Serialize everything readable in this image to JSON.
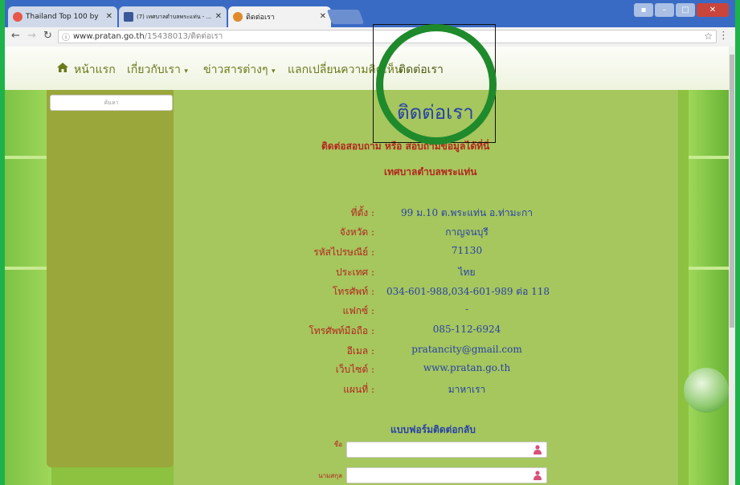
{
  "browser": {
    "tabs": [
      {
        "label": "Thailand Top 100 by",
        "icon_color": "#e8574a"
      },
      {
        "label": "(7) เทศบาลตำบลพระแท่น - ...",
        "icon_color": "#3b5998"
      },
      {
        "label": "ติดต่อเรา",
        "icon_color": "#e08a2c"
      }
    ],
    "url_host": "www.pratan.go.th",
    "url_path": "/15438013/ติดต่อเรา"
  },
  "nav": {
    "home": "หน้าแรก",
    "about": "เกี่ยวกับเรา",
    "news": "ข่าวสารต่างๆ",
    "exchange": "แลกเปลี่ยนความคิดเห็น",
    "contact": "ติดต่อเรา"
  },
  "sidebar": {
    "search_label": "ค้นหา"
  },
  "page": {
    "heading": "ติดต่อเรา",
    "intro": "ติดต่อสอบถาม หรือ สอบถามข้อมูลได้ที่นี่",
    "org_name": "เทศบาลตำบลพระแท่น"
  },
  "contact_rows": [
    {
      "label": "ที่ตั้ง :",
      "value": "99 ม.10 ต.พระแท่น อ.ท่ามะกา"
    },
    {
      "label": "จังหวัด :",
      "value": "กาญจนบุรี"
    },
    {
      "label": "รหัสไปรษณีย์ :",
      "value": "71130"
    },
    {
      "label": "ประเทศ :",
      "value": "ไทย"
    },
    {
      "label": "โทรศัพท์ :",
      "value": "034-601-988,034-601-989 ต่อ 118"
    },
    {
      "label": "แฟกซ์ :",
      "value": "-"
    },
    {
      "label": "โทรศัพท์มือถือ :",
      "value": "085-112-6924"
    },
    {
      "label": "อีเมล :",
      "value": "pratancity@gmail.com"
    },
    {
      "label": "เว็บไซต์ :",
      "value": "www.pratan.go.th"
    },
    {
      "label": "แผนที่ :",
      "value": "มาหาเรา"
    }
  ],
  "form": {
    "title": "แบบฟอร์มติดต่อกลับ",
    "name_label": "ชื่อ",
    "surname_label": "นามสกุล"
  },
  "colors": {
    "accent_red": "#b3261e",
    "accent_blue": "#2742a6",
    "annotation_green": "#1e8a2c"
  }
}
